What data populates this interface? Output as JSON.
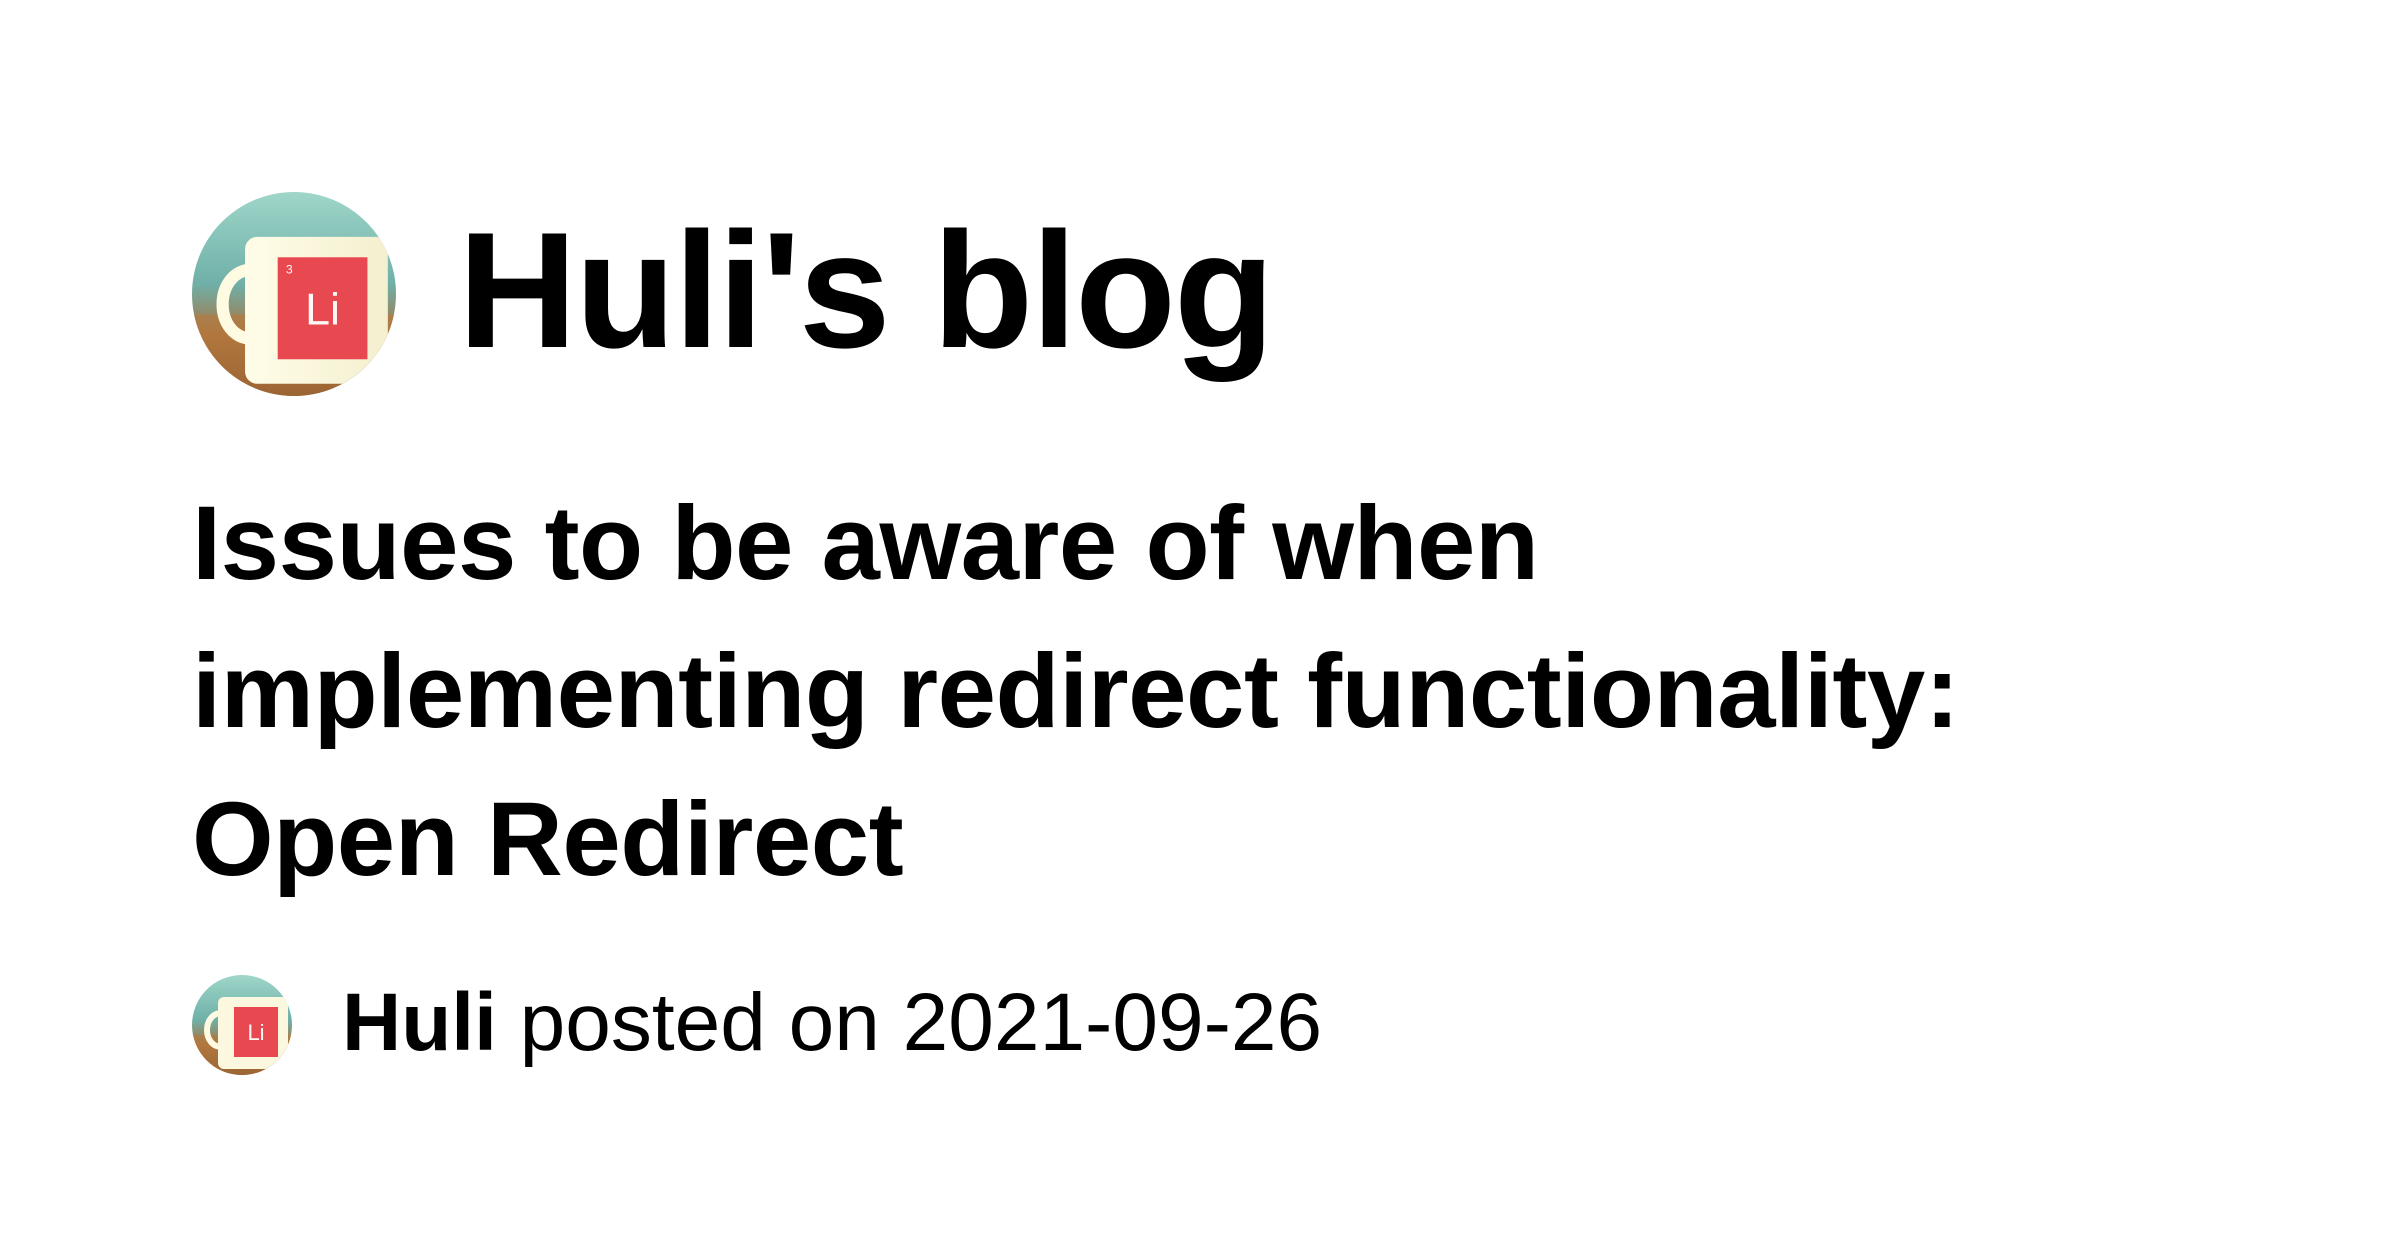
{
  "site": {
    "title": "Huli's blog",
    "avatar_icon": "mug-avatar"
  },
  "post": {
    "title": "Issues to be aware of when implementing redirect functionality: Open Redirect",
    "author": "Huli",
    "posted_on_label": " posted on ",
    "date": "2021-09-26"
  },
  "colors": {
    "background": "#ffffff",
    "text": "#000000",
    "mug_red": "#e8484f"
  }
}
